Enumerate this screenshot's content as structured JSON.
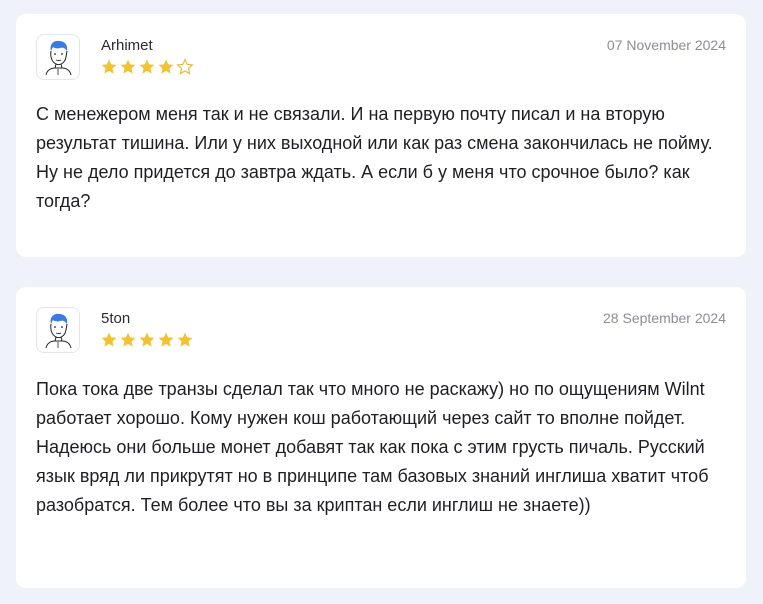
{
  "reviews": [
    {
      "author": "Arhimet",
      "date": "07 November 2024",
      "rating": 4,
      "rating_max": 5,
      "avatar_icon": "user-avatar-icon",
      "text": "С менежером меня так и не связали. И на первую почту писал и на вторую результат тишина. Или у них выходной или как раз смена закончилась не пойму. Ну не дело придется до завтра ждать. А если б у меня что срочное было? как тогда?"
    },
    {
      "author": "5ton",
      "date": "28 September 2024",
      "rating": 5,
      "rating_max": 5,
      "avatar_icon": "user-avatar-icon",
      "text": "Пока тока две транзы сделал так что много не раскажу) но по ощущениям Wilnt работает хорошо. Кому нужен кош работающий через сайт то вполне пойдет. Надеюсь они больше монет добавят так как пока с этим грусть пичаль. Русский язык вряд ли прикрутят но в принципе там базовых знаний инглиша хватит чтоб разобратся. Тем более что вы за криптан если инглиш не знаете))"
    }
  ],
  "colors": {
    "page_bg": "#eff2f8",
    "card_bg": "#ffffff",
    "star_filled": "#f1c232",
    "star_empty_stroke": "#e5b82e",
    "avatar_hair": "#3e7be0"
  }
}
